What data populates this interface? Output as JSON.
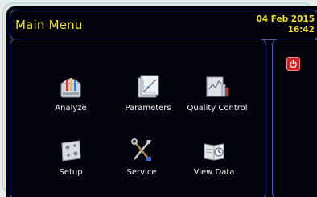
{
  "header": {
    "title": "Main Menu",
    "date": "04 Feb 2015",
    "time": "16:42"
  },
  "menu": [
    {
      "label": "Analyze",
      "icon": "analyzer-icon"
    },
    {
      "label": "Parameters",
      "icon": "parameters-icon"
    },
    {
      "label": "Quality Control",
      "icon": "quality-control-icon"
    },
    {
      "label": "Setup",
      "icon": "setup-icon"
    },
    {
      "label": "Service",
      "icon": "service-tools-icon"
    },
    {
      "label": "View Data",
      "icon": "view-data-icon"
    }
  ],
  "side": {
    "power_icon": "power-icon"
  },
  "colors": {
    "accent_text": "#f0e020",
    "panel_border": "#4a5cc8",
    "power_button": "#d42020"
  }
}
